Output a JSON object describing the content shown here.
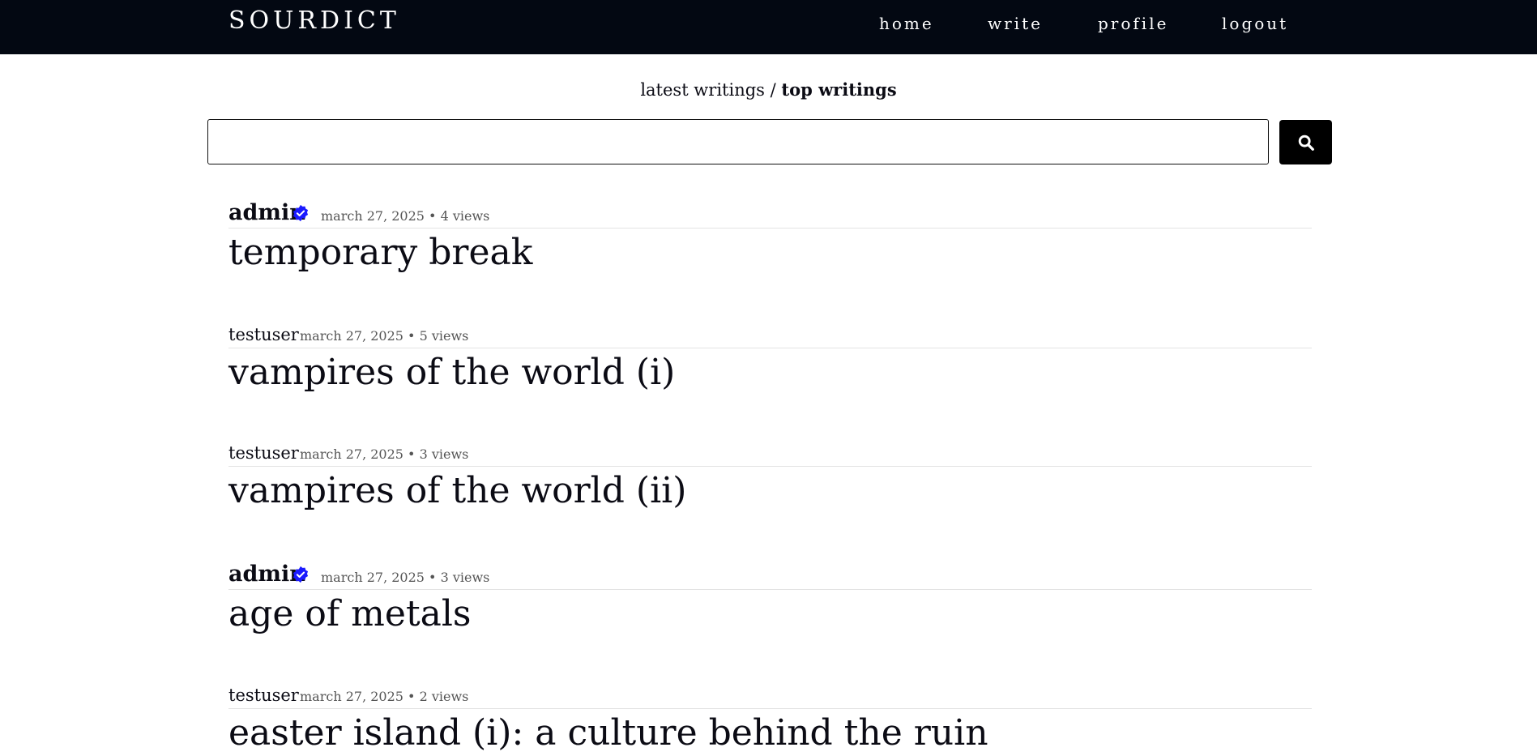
{
  "brand": "SOURDICT",
  "nav": {
    "home": "home",
    "write": "write",
    "profile": "profile",
    "logout": "logout"
  },
  "feed_switch": {
    "latest": "latest writings",
    "separator": "/",
    "top": "top writings"
  },
  "search": {
    "value": "",
    "placeholder": "",
    "button_icon": "search-icon"
  },
  "verified_color": "#1a1aff",
  "posts": [
    {
      "author": "admin",
      "verified": true,
      "meta": "march 27, 2025 • 4 views",
      "title": "temporary break"
    },
    {
      "author": "testuser",
      "verified": false,
      "meta": "march 27, 2025 • 5 views",
      "title": "vampires of the world (i)"
    },
    {
      "author": "testuser",
      "verified": false,
      "meta": "march 27, 2025 • 3 views",
      "title": "vampires of the world (ii)"
    },
    {
      "author": "admin",
      "verified": true,
      "meta": "march 27, 2025 • 3 views",
      "title": "age of metals"
    },
    {
      "author": "testuser",
      "verified": false,
      "meta": "march 27, 2025 • 2 views",
      "title": "easter island (i): a culture behind the ruin"
    }
  ]
}
